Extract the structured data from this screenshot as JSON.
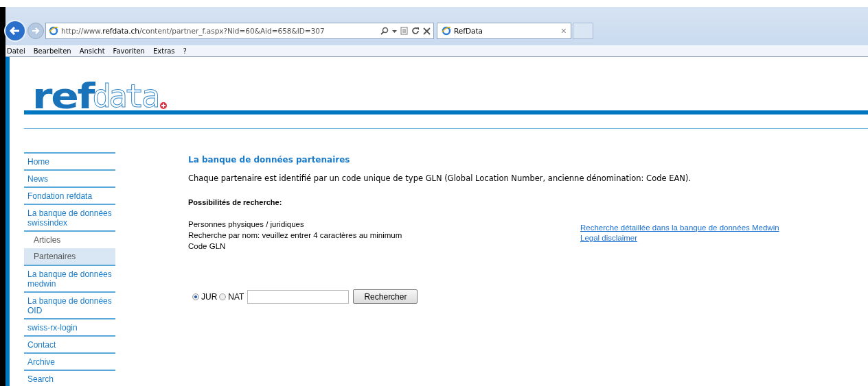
{
  "browser": {
    "url": "http://www.**refdata.ch**/content/partner_f.aspx?Nid=60&Aid=658&ID=307",
    "tab": {
      "title": "RefData",
      "close": "×"
    },
    "menu": [
      "Datei",
      "Bearbeiten",
      "Ansicht",
      "Favoriten",
      "Extras",
      "?"
    ]
  },
  "logo": {
    "solid": "ref",
    "outline": "data"
  },
  "sidebar": {
    "items": [
      {
        "label": "Home",
        "kind": "main",
        "selected": false
      },
      {
        "label": "News",
        "kind": "main",
        "selected": false
      },
      {
        "label": "Fondation refdata",
        "kind": "main",
        "selected": false
      },
      {
        "label": "La banque de données swissindex",
        "kind": "main",
        "selected": false
      },
      {
        "label": "Articles",
        "kind": "sub",
        "selected": false
      },
      {
        "label": "Partenaires",
        "kind": "sub",
        "selected": true
      },
      {
        "label": "La banque de données medwin",
        "kind": "main",
        "selected": false
      },
      {
        "label": "La banque de données OID",
        "kind": "main",
        "selected": false
      },
      {
        "label": "swiss-rx-login",
        "kind": "main",
        "selected": false
      },
      {
        "label": "Contact",
        "kind": "main",
        "selected": false
      },
      {
        "label": "Archive",
        "kind": "main",
        "selected": false
      },
      {
        "label": "Search",
        "kind": "main",
        "selected": false
      }
    ]
  },
  "content": {
    "title": "La banque de données partenaires",
    "intro": "Chaque partenaire est identifié par un code unique de type GLN (Global Location Number, ancienne dénomination: Code EAN).",
    "options_heading": "Possibilités de recherche:",
    "options": [
      "Personnes physiques / juridiques",
      "Recherche par nom: veuillez entrer 4 caractères au minimum",
      "Code GLN"
    ],
    "links": [
      "Recherche détaillée dans la banque de données Medwin",
      "Legal disclaimer"
    ],
    "search": {
      "radios": [
        {
          "label": "JUR",
          "selected": true
        },
        {
          "label": "NAT",
          "selected": false
        }
      ],
      "button": "Rechercher"
    }
  }
}
